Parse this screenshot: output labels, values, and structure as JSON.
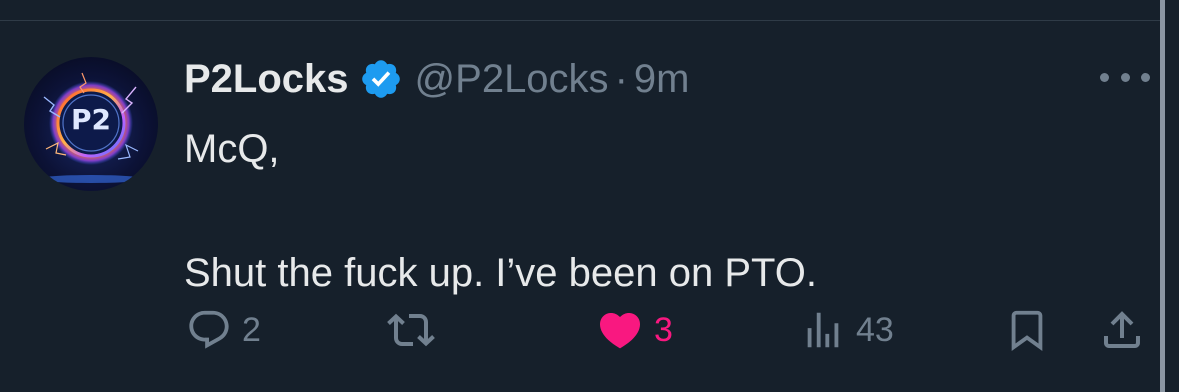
{
  "tweet": {
    "display_name": "P2Locks",
    "handle": "@P2Locks",
    "separator": "·",
    "time": "9m",
    "avatar_text": "P2",
    "lines": [
      "McQ,",
      "Shut the fuck up. I’ve been on PTO."
    ]
  },
  "actions": {
    "replies": "2",
    "likes": "3",
    "views": "43"
  },
  "colors": {
    "background": "#16202b",
    "text": "#e7e9ea",
    "muted": "#71808f",
    "verified": "#1d9bf0",
    "like": "#f91880"
  },
  "icons": {
    "reply": "speech-bubble-icon",
    "retweet": "retweet-icon",
    "like": "heart-filled-icon",
    "views": "bar-chart-icon",
    "bookmark": "bookmark-icon",
    "share": "share-upload-icon",
    "more": "ellipsis-icon",
    "verified": "verified-badge-icon"
  }
}
